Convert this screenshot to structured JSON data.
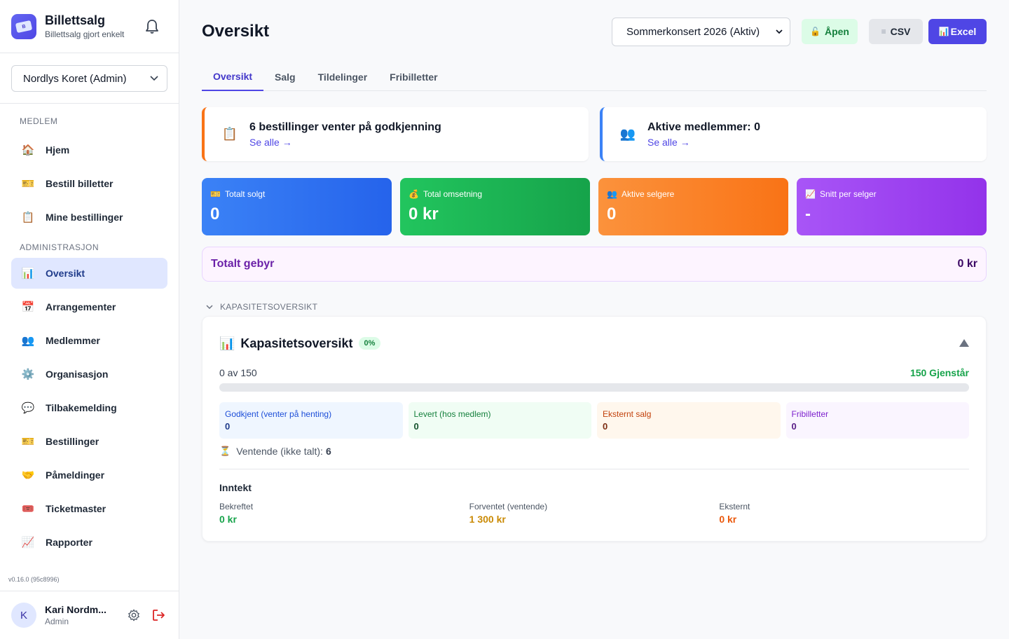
{
  "brand": {
    "title": "Billettsalg",
    "subtitle": "Billettsalg gjort enkelt"
  },
  "org_select": {
    "value": "Nordlys Koret (Admin)"
  },
  "sidebar": {
    "member_section": "MEDLEM",
    "member_items": [
      {
        "label": "Hjem",
        "icon": "house-icon"
      },
      {
        "label": "Bestill billetter",
        "icon": "ticket-icon"
      },
      {
        "label": "Mine bestillinger",
        "icon": "clipboard-icon"
      }
    ],
    "admin_section": "ADMINISTRASJON",
    "admin_items": [
      {
        "label": "Oversikt",
        "icon": "bar-chart-icon",
        "active": true
      },
      {
        "label": "Arrangementer",
        "icon": "calendar-icon"
      },
      {
        "label": "Medlemmer",
        "icon": "people-icon"
      },
      {
        "label": "Organisasjon",
        "icon": "gear-icon"
      },
      {
        "label": "Tilbakemelding",
        "icon": "speech-bubble-icon"
      },
      {
        "label": "Bestillinger",
        "icon": "ticket-icon"
      },
      {
        "label": "Påmeldinger",
        "icon": "handshake-icon"
      },
      {
        "label": "Ticketmaster",
        "icon": "admission-ticket-icon"
      },
      {
        "label": "Rapporter",
        "icon": "line-chart-icon"
      }
    ],
    "version": "v0.16.0 (95c8996)"
  },
  "user": {
    "initial": "K",
    "name": "Kari Nordm...",
    "role": "Admin"
  },
  "header": {
    "title": "Oversikt",
    "event_select": "Sommerkonsert 2026 (Aktiv)",
    "open_label": "Åpen",
    "csv_label": "CSV",
    "excel_label": "Excel"
  },
  "tabs": [
    {
      "label": "Oversikt",
      "active": true
    },
    {
      "label": "Salg"
    },
    {
      "label": "Tildelinger"
    },
    {
      "label": "Fribilletter"
    }
  ],
  "alerts": [
    {
      "title": "6 bestillinger venter på godkjenning",
      "link": "Se alle →",
      "icon": "clipboard-icon",
      "color": "#f97316"
    },
    {
      "title": "Aktive medlemmer: 0",
      "link": "Se alle →",
      "icon": "people-icon",
      "color": "#3b82f6"
    }
  ],
  "stats": [
    {
      "label": "Totalt solgt",
      "value": "0",
      "icon": "ticket-icon"
    },
    {
      "label": "Total omsetning",
      "value": "0 kr",
      "icon": "money-bag-icon"
    },
    {
      "label": "Aktive selgere",
      "value": "0",
      "icon": "people-icon"
    },
    {
      "label": "Snitt per selger",
      "value": "-",
      "icon": "line-chart-icon"
    }
  ],
  "fee": {
    "label": "Totalt gebyr",
    "value": "0 kr"
  },
  "capacity_section_label": "KAPASITETSOVERSIKT",
  "capacity": {
    "title": "Kapasitetsoversikt",
    "badge": "0%",
    "used_text": "0 av 150",
    "remaining_text": "150 Gjenstår",
    "progress_fraction": 0,
    "boxes": [
      {
        "label": "Godkjent (venter på henting)",
        "value": "0"
      },
      {
        "label": "Levert (hos medlem)",
        "value": "0"
      },
      {
        "label": "Eksternt salg",
        "value": "0"
      },
      {
        "label": "Fribilletter",
        "value": "0"
      }
    ],
    "pending_label": "Ventende (ikke talt):",
    "pending_value": "6",
    "income_title": "Inntekt",
    "income": [
      {
        "label": "Bekreftet",
        "value": "0 kr"
      },
      {
        "label": "Forventet (ventende)",
        "value": "1 300 kr"
      },
      {
        "label": "Eksternt",
        "value": "0 kr"
      }
    ]
  }
}
